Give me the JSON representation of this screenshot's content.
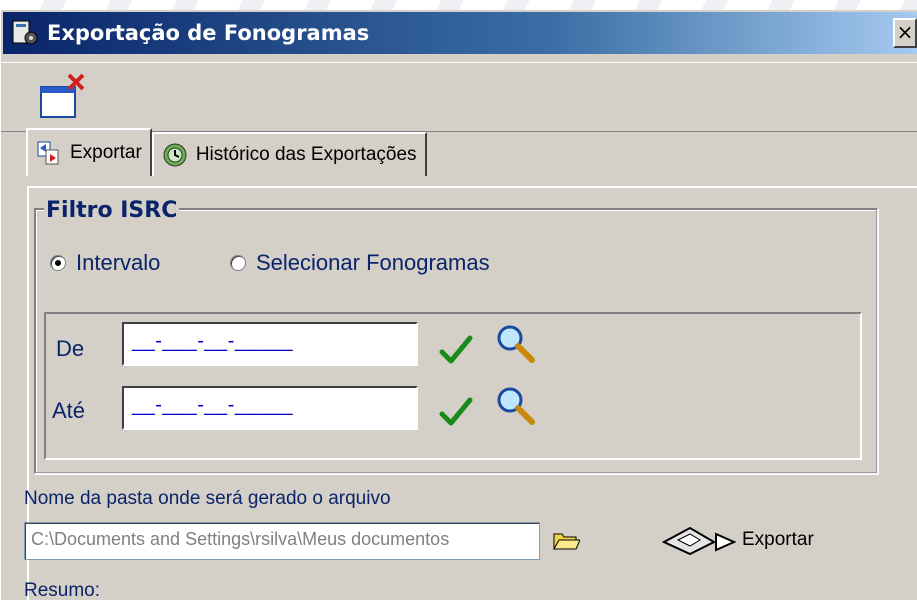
{
  "window": {
    "title": "Exportação de Fonogramas",
    "close_glyph": "×"
  },
  "toolbar": {
    "close_window_icon": "window-close-icon"
  },
  "tabs": [
    {
      "label": "Exportar",
      "icon": "export-document-icon",
      "active": true
    },
    {
      "label": "Histórico das Exportações",
      "icon": "history-globe-icon",
      "active": false
    }
  ],
  "filter": {
    "title": "Filtro ISRC",
    "options": [
      {
        "label": "Intervalo",
        "checked": true
      },
      {
        "label": "Selecionar Fonogramas",
        "checked": false
      }
    ],
    "from": {
      "label": "De",
      "value": "__-___-__-_____"
    },
    "to": {
      "label": "Até",
      "value": "__-___-__-_____"
    }
  },
  "output": {
    "folder_label": "Nome da pasta onde será gerado o arquivo",
    "path_value": "C:\\Documents and Settings\\rsilva\\Meus documentos",
    "export_label": "Exportar",
    "summary_label": "Resumo:"
  },
  "colors": {
    "title_start": "#0a246a",
    "title_end": "#a6caf0",
    "window_bg": "#d4d0c8",
    "label_blue": "#0a246a",
    "check_green": "#1a8a1a"
  }
}
